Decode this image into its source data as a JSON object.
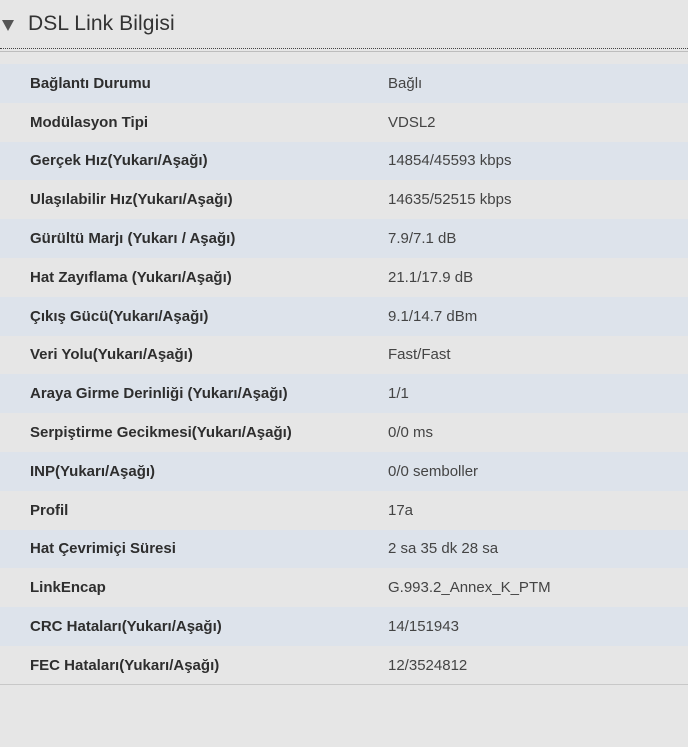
{
  "section": {
    "title": "DSL Link Bilgisi"
  },
  "rows": [
    {
      "label": "Bağlantı Durumu",
      "value": "Bağlı"
    },
    {
      "label": "Modülasyon Tipi",
      "value": "VDSL2"
    },
    {
      "label": "Gerçek Hız(Yukarı/Aşağı)",
      "value": "14854/45593 kbps"
    },
    {
      "label": "Ulaşılabilir Hız(Yukarı/Aşağı)",
      "value": "14635/52515 kbps"
    },
    {
      "label": "Gürültü Marjı (Yukarı / Aşağı)",
      "value": "7.9/7.1 dB"
    },
    {
      "label": "Hat Zayıflama (Yukarı/Aşağı)",
      "value": "21.1/17.9 dB"
    },
    {
      "label": "Çıkış Gücü(Yukarı/Aşağı)",
      "value": "9.1/14.7 dBm"
    },
    {
      "label": "Veri Yolu(Yukarı/Aşağı)",
      "value": "Fast/Fast"
    },
    {
      "label": "Araya Girme Derinliği (Yukarı/Aşağı)",
      "value": "1/1"
    },
    {
      "label": "Serpiştirme Gecikmesi(Yukarı/Aşağı)",
      "value": "0/0 ms"
    },
    {
      "label": "INP(Yukarı/Aşağı)",
      "value": "0/0 semboller"
    },
    {
      "label": "Profil",
      "value": "17a"
    },
    {
      "label": "Hat Çevrimiçi Süresi",
      "value": "2 sa 35 dk 28 sa"
    },
    {
      "label": "LinkEncap",
      "value": "G.993.2_Annex_K_PTM"
    },
    {
      "label": "CRC Hataları(Yukarı/Aşağı)",
      "value": "14/151943"
    },
    {
      "label": "FEC Hataları(Yukarı/Aşağı)",
      "value": "12/3524812"
    }
  ]
}
